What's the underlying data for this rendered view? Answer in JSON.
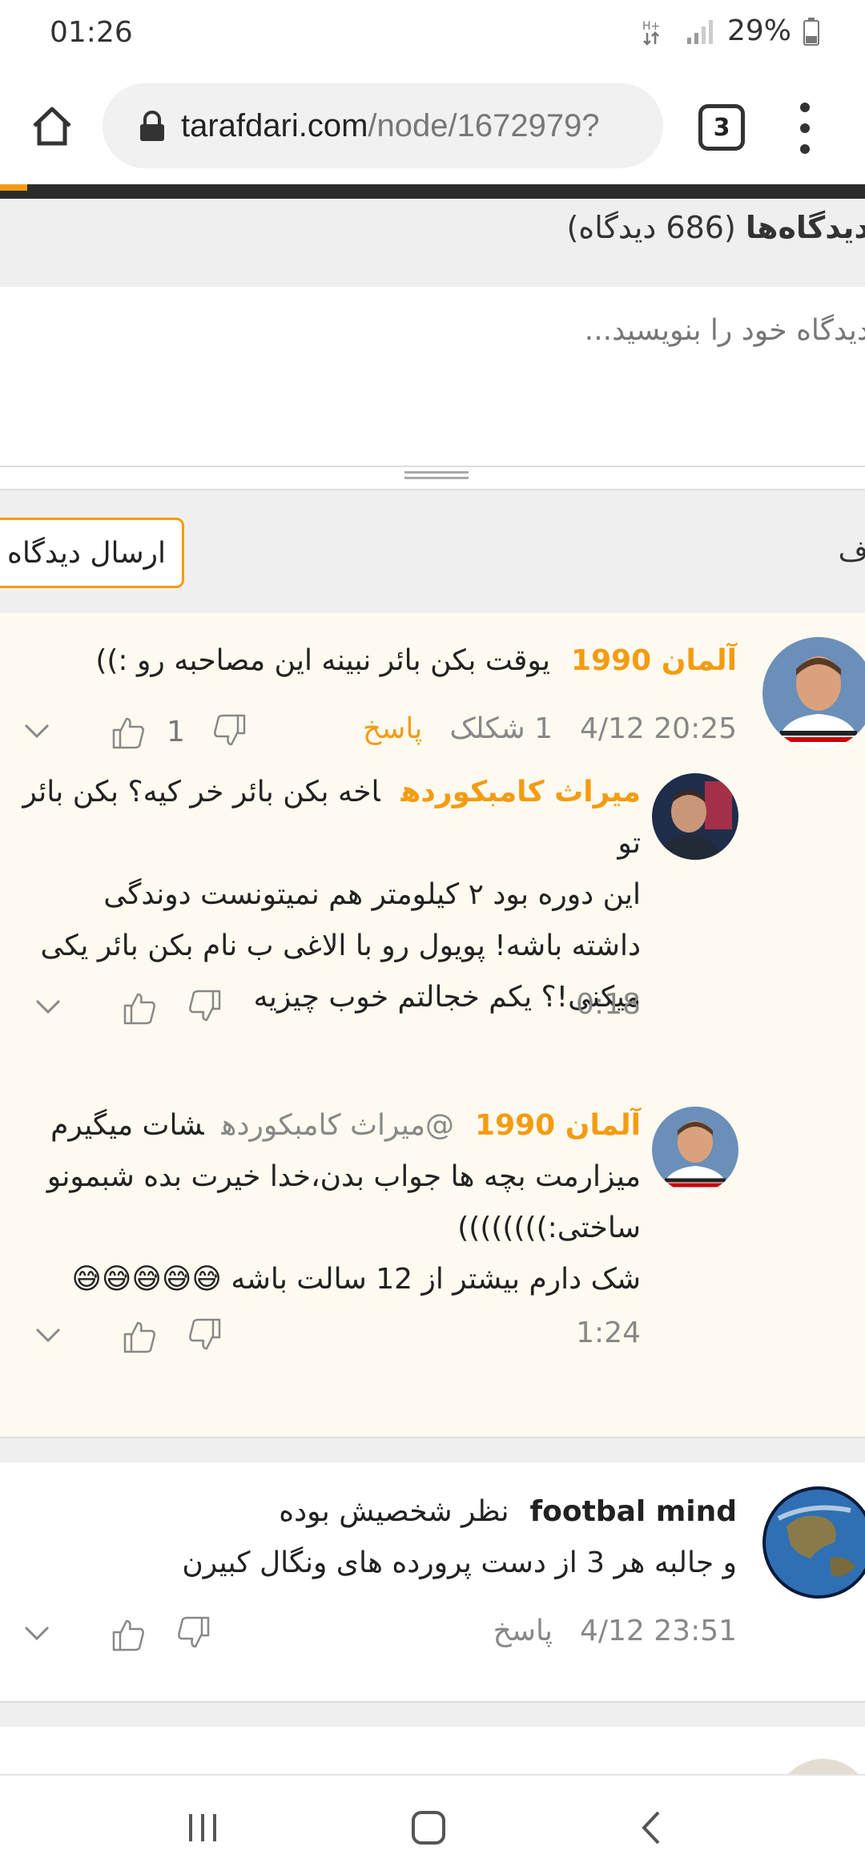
{
  "status_bar": {
    "time": "01:26",
    "battery": "29%"
  },
  "browser": {
    "url_host": "tarafdari.com",
    "url_path": "/node/1672979?",
    "tab_count": "3"
  },
  "comments_section": {
    "title": "دیدگاه‌ها",
    "count_label": "(686 دیدگاه)",
    "placeholder": "دیدگاه خود را بنویسید...",
    "submit_label": "ارسال دیدگاه",
    "side_fragment": "ف"
  },
  "threads": [
    {
      "comment": {
        "author": "آلمان 1990",
        "text": "یوقت بکن بائر نبینه این مصاحبه رو :))",
        "date": "4/12 20:25",
        "reactions": "1 شکلک",
        "reply": "پاسخ",
        "likes": "1"
      },
      "replies": [
        {
          "author": "میراث کامبکورده",
          "lines": [
            "اخه بکن بائر خر کیه؟ بکن بائر تو",
            "این دوره بود ۲ کیلومتر هم نمیتونست دوندگی",
            "داشته باشه! پویول رو با الاغی ب نام بکن بائر یکی",
            "میکنی!؟ یکم خجالتم خوب چیزیه"
          ],
          "time": "0:18"
        },
        {
          "author": "آلمان 1990",
          "mention": "@میراث کامبکورده",
          "lines": [
            "شات میگیرم",
            "میزارمت بچه ها جواب بدن،خدا خیرت بده شبمونو",
            "ساختی:))))))))",
            "شک دارم بیشتر از 12 سالت باشه 😅😅😅😅😅"
          ],
          "time": "1:24"
        }
      ]
    },
    {
      "comment": {
        "author": "footbal mind",
        "lines": [
          "نظر شخصیش بوده",
          "و جالبه هر 3 از دست پرورده های ونگال کبیرن"
        ],
        "date": "4/12 23:51",
        "reply": "پاسخ"
      }
    }
  ],
  "colors": {
    "accent": "#f39c12",
    "thread_bg": "#fefaf0",
    "header_bg": "#efefef"
  }
}
